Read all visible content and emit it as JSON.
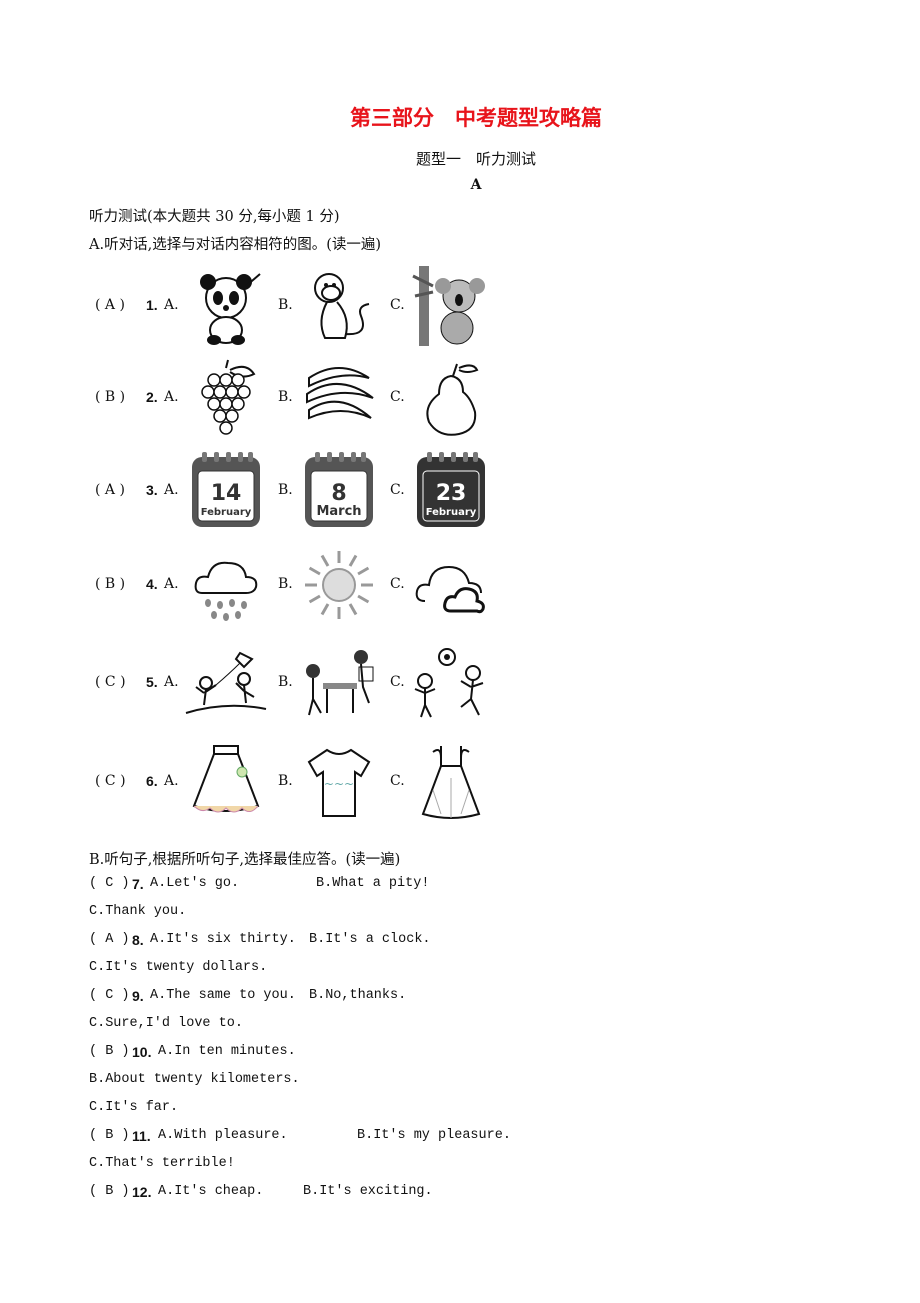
{
  "title": "第三部分　中考题型攻略篇",
  "subtitle": "题型一　听力测试",
  "section": "A",
  "intro": "听力测试(本大题共 30 分,每小题 1 分)",
  "partA": {
    "instruction": "A.听对话,选择与对话内容相符的图。(读一遍)",
    "questions": [
      {
        "answer": "( A )",
        "num": "1.",
        "pics": [
          "panda",
          "monkey",
          "koala"
        ]
      },
      {
        "answer": "( B )",
        "num": "2.",
        "pics": [
          "grapes",
          "bananas",
          "pear"
        ]
      },
      {
        "answer": "( A )",
        "num": "3.",
        "pics": [
          "calendar",
          "calendar",
          "calendar"
        ],
        "calendars": [
          {
            "day": "14",
            "month": "February"
          },
          {
            "day": "8",
            "month": "March"
          },
          {
            "day": "23",
            "month": "February"
          }
        ]
      },
      {
        "answer": "( B )",
        "num": "4.",
        "pics": [
          "rain-cloud",
          "sun",
          "cloudy"
        ]
      },
      {
        "answer": "( C )",
        "num": "5.",
        "pics": [
          "flying-kite",
          "playing-chess",
          "playing-football"
        ]
      },
      {
        "answer": "( C )",
        "num": "6.",
        "pics": [
          "skirt",
          "t-shirt",
          "dress"
        ]
      }
    ],
    "option_labels": [
      "A.",
      "B.",
      "C."
    ]
  },
  "partB": {
    "instruction": "B.听句子,根据所听句子,选择最佳应答。(读一遍)",
    "questions": [
      {
        "answer": "( C )",
        "num": "7.",
        "a": "A.Let's go.",
        "b": "B.What a pity!",
        "c": "C.Thank you."
      },
      {
        "answer": "( A )",
        "num": "8.",
        "a": "A.It's six thirty.",
        "b": "B.It's a clock.",
        "c": "C.It's twenty dollars."
      },
      {
        "answer": "( C )",
        "num": "9.",
        "a": "A.The same to you.",
        "b": "B.No,thanks.",
        "c": "C.Sure,I'd love to."
      },
      {
        "answer": "( B )",
        "num": "10.",
        "a": "A.In ten minutes.",
        "b": "B.About twenty kilometers.",
        "c": "C.It's far."
      },
      {
        "answer": "( B )",
        "num": "11.",
        "a": "A.With pleasure.",
        "b": "B.It's my pleasure.",
        "c": "C.That's terrible!"
      },
      {
        "answer": "( B )",
        "num": "12.",
        "a": "A.It's cheap.",
        "b": "B.It's exciting."
      }
    ]
  },
  "colors": {
    "title": "#e8141b",
    "text": "#111111"
  }
}
